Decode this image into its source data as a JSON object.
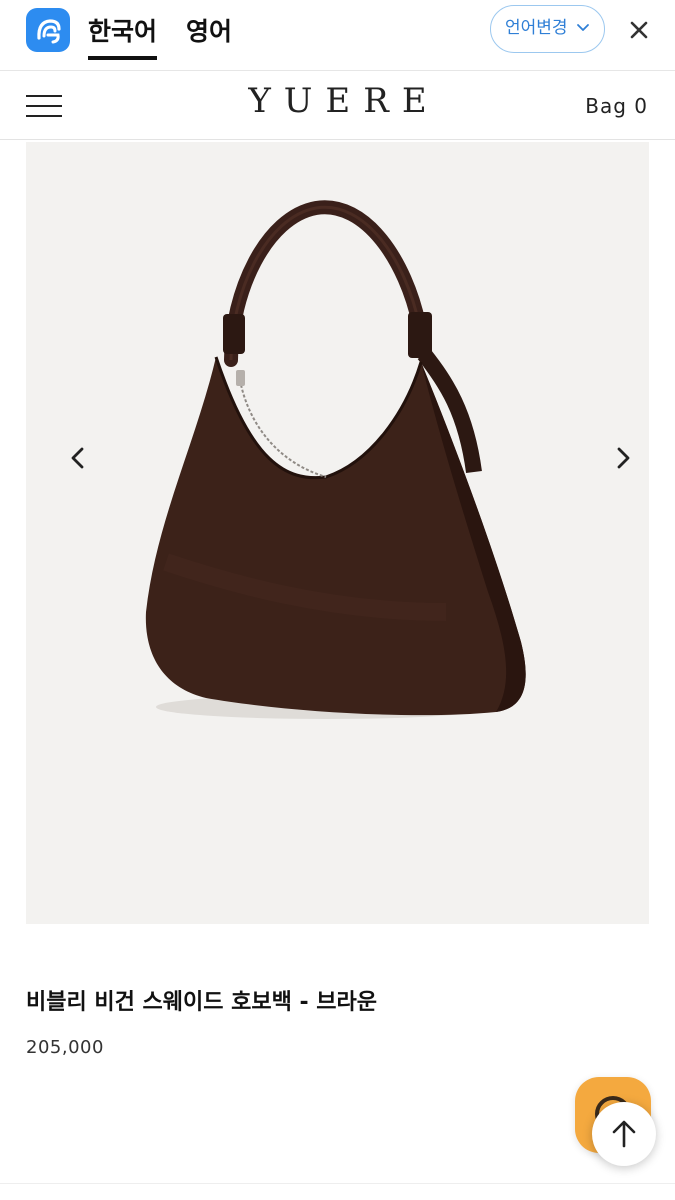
{
  "translate_bar": {
    "tabs": [
      {
        "label": "한국어",
        "active": true
      },
      {
        "label": "영어",
        "active": false
      }
    ],
    "language_button": "언어변경",
    "icons": [
      "translator-app-icon",
      "chevron-down-icon",
      "close-icon"
    ]
  },
  "header": {
    "brand": "YUERE",
    "bag_label": "Bag 0",
    "icons": [
      "hamburger-menu-icon"
    ]
  },
  "product": {
    "image_description_icon": "product-image",
    "title": "비블리 비건 스웨이드 호보백 - 브라운",
    "price": "205,000",
    "colors": {
      "image_background": "#f3f2f0",
      "bag_brown": "#3c2219"
    }
  },
  "floating": {
    "icons": [
      "chat-icon",
      "arrow-up-icon"
    ],
    "chat_color": "#f4a93f"
  },
  "carousel": {
    "icons": [
      "chevron-left-icon",
      "chevron-right-icon"
    ]
  }
}
